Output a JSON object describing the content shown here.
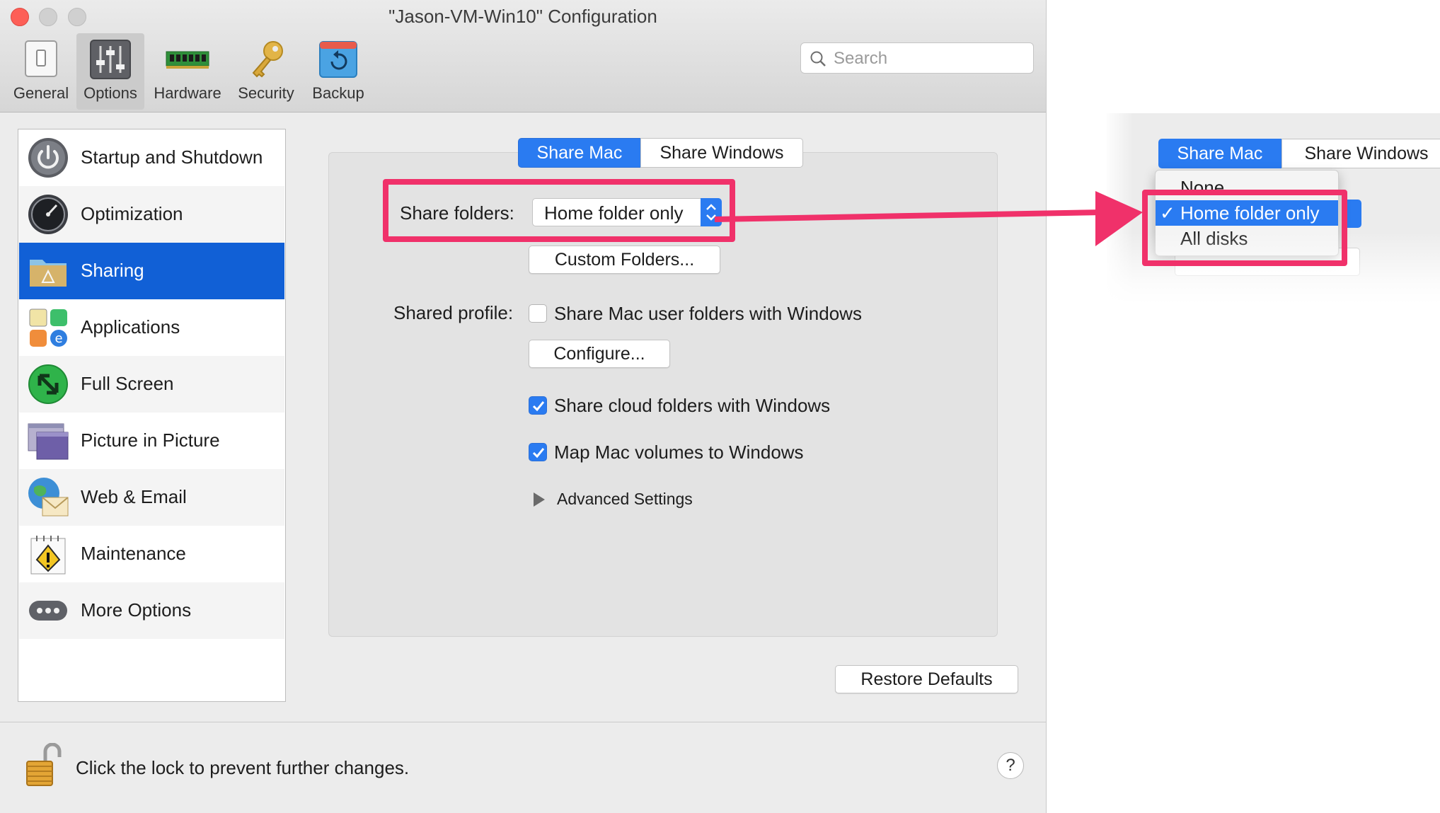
{
  "window": {
    "title": "\"Jason-VM-Win10\" Configuration"
  },
  "toolbar": {
    "items": [
      {
        "label": "General",
        "icon": "switch-icon"
      },
      {
        "label": "Options",
        "icon": "sliders-icon",
        "active": true
      },
      {
        "label": "Hardware",
        "icon": "memory-chip-icon"
      },
      {
        "label": "Security",
        "icon": "key-icon"
      },
      {
        "label": "Backup",
        "icon": "backup-icon"
      }
    ],
    "search_placeholder": "Search"
  },
  "sidebar": {
    "items": [
      {
        "label": "Startup and Shutdown",
        "icon": "power-icon"
      },
      {
        "label": "Optimization",
        "icon": "speedometer-icon"
      },
      {
        "label": "Sharing",
        "icon": "shared-folder-icon",
        "selected": true
      },
      {
        "label": "Applications",
        "icon": "applications-icon"
      },
      {
        "label": "Full Screen",
        "icon": "full-screen-icon"
      },
      {
        "label": "Picture in Picture",
        "icon": "picture-in-picture-icon"
      },
      {
        "label": "Web & Email",
        "icon": "web-email-icon"
      },
      {
        "label": "Maintenance",
        "icon": "maintenance-icon"
      },
      {
        "label": "More Options",
        "icon": "more-options-icon"
      }
    ],
    "selected_color": "#1160d6"
  },
  "sharing": {
    "tabs": [
      {
        "label": "Share Mac",
        "active": true
      },
      {
        "label": "Share Windows",
        "active": false
      }
    ],
    "share_folders_label": "Share folders:",
    "share_folders_value": "Home folder only",
    "custom_folders_button": "Custom Folders...",
    "shared_profile_label": "Shared profile:",
    "share_user_folders_label": "Share Mac user folders with Windows",
    "share_user_folders_checked": false,
    "configure_button": "Configure...",
    "share_cloud_label": "Share cloud folders with Windows",
    "share_cloud_checked": true,
    "map_volumes_label": "Map Mac volumes to Windows",
    "map_volumes_checked": true,
    "advanced_settings_label": "Advanced Settings",
    "restore_defaults_button": "Restore Defaults"
  },
  "status": {
    "lock_text": "Click the lock to prevent further changes.",
    "help_label": "?"
  },
  "zoom_inset": {
    "tabs": [
      {
        "label": "Share Mac"
      },
      {
        "label": "Share Windows"
      }
    ],
    "menu_items": [
      {
        "label": "None",
        "checked": false
      },
      {
        "label": "Home folder only",
        "checked": true
      },
      {
        "label": "All disks",
        "checked": false
      }
    ],
    "checkmark": "✓"
  },
  "colors": {
    "accent": "#2a7bf1",
    "annotation": "#f0316a"
  }
}
